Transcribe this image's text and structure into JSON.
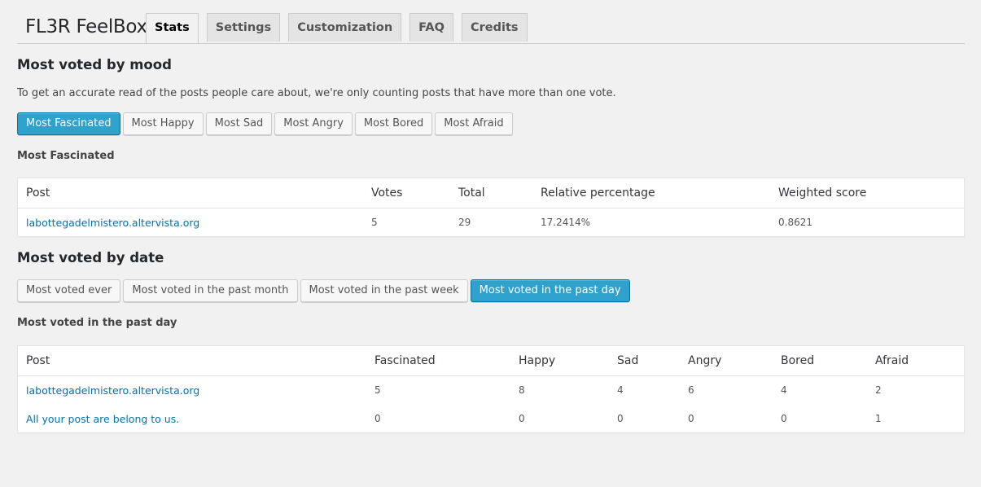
{
  "page": {
    "title": "FL3R FeelBox"
  },
  "tabs": [
    {
      "label": "Stats",
      "active": true
    },
    {
      "label": "Settings",
      "active": false
    },
    {
      "label": "Customization",
      "active": false
    },
    {
      "label": "FAQ",
      "active": false
    },
    {
      "label": "Credits",
      "active": false
    }
  ],
  "mood_section": {
    "heading": "Most voted by mood",
    "description": "To get an accurate read of the posts people care about, we're only counting posts that have more than one vote.",
    "buttons": [
      "Most Fascinated",
      "Most Happy",
      "Most Sad",
      "Most Angry",
      "Most Bored",
      "Most Afraid"
    ],
    "selected": "Most Fascinated",
    "subheading": "Most Fascinated",
    "table": {
      "headers": [
        "Post",
        "Votes",
        "Total",
        "Relative percentage",
        "Weighted score"
      ],
      "rows": [
        [
          "labottegadelmistero.altervista.org",
          "5",
          "29",
          "17.2414%",
          "0.8621"
        ]
      ]
    }
  },
  "date_section": {
    "heading": "Most voted by date",
    "buttons": [
      "Most voted ever",
      "Most voted in the past month",
      "Most voted in the past week",
      "Most voted in the past day"
    ],
    "selected": "Most voted in the past day",
    "subheading": "Most voted in the past day",
    "table": {
      "headers": [
        "Post",
        "Fascinated",
        "Happy",
        "Sad",
        "Angry",
        "Bored",
        "Afraid"
      ],
      "rows": [
        [
          "labottegadelmistero.altervista.org",
          "5",
          "8",
          "4",
          "6",
          "4",
          "2"
        ],
        [
          "All your post are belong to us.",
          "0",
          "0",
          "0",
          "0",
          "0",
          "1"
        ]
      ]
    }
  },
  "colors": {
    "primary_button": "#2ea2cc",
    "link": "#0073aa",
    "background": "#f1f1f1"
  }
}
